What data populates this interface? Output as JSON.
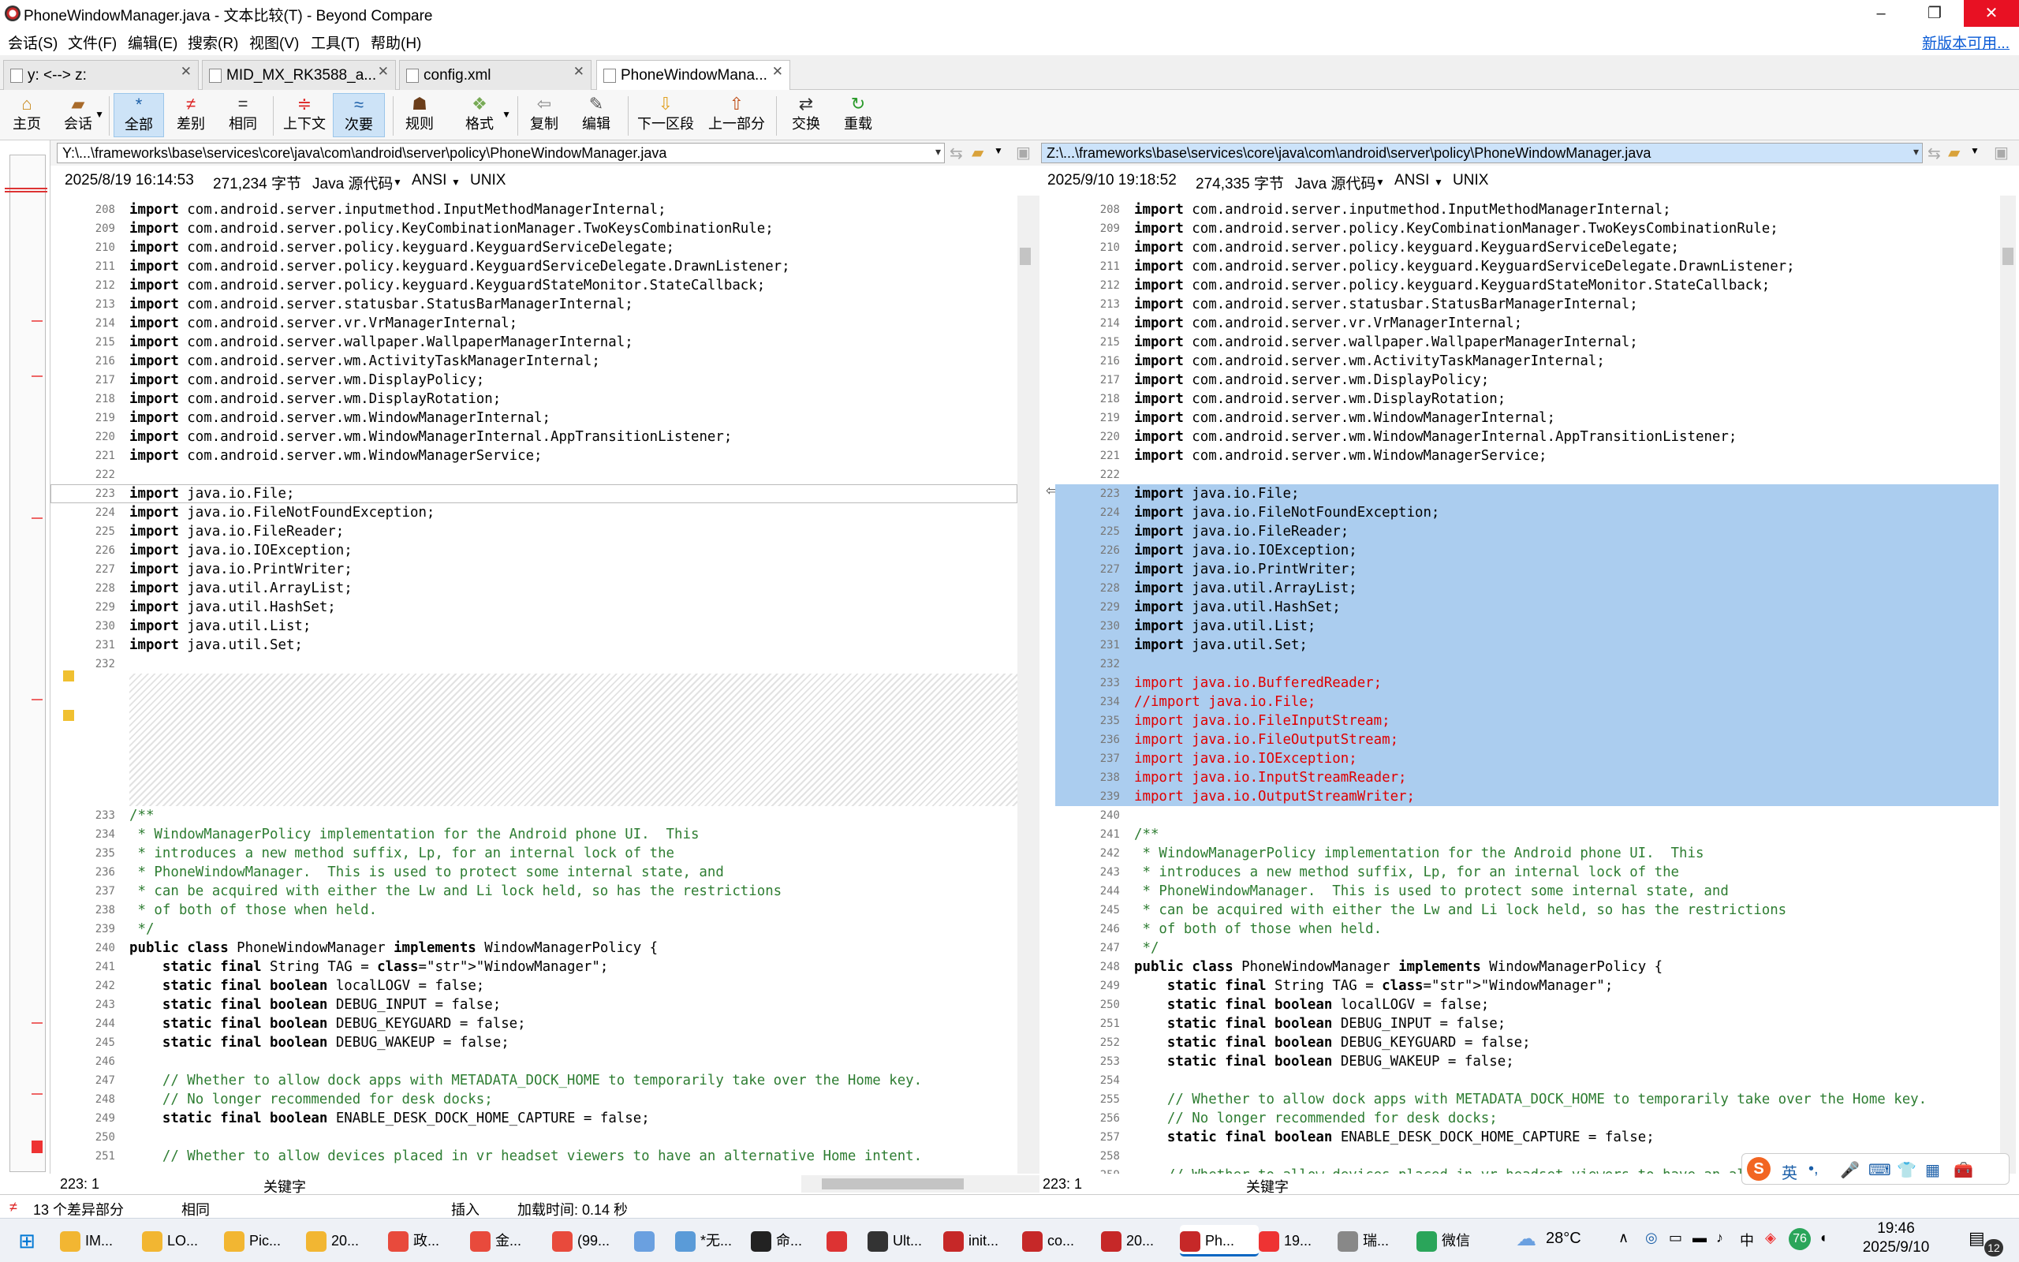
{
  "window": {
    "title": "PhoneWindowManager.java - 文本比较(T) - Beyond Compare",
    "minimize": "–",
    "restore": "❐",
    "close": "✕"
  },
  "menu": [
    "会话(S)",
    "文件(F)",
    "编辑(E)",
    "搜索(R)",
    "视图(V)",
    "工具(T)",
    "帮助(H)"
  ],
  "update_link": "新版本可用...",
  "tabs": [
    {
      "label": "y: <--> z:"
    },
    {
      "label": "MID_MX_RK3588_a..."
    },
    {
      "label": "config.xml"
    },
    {
      "label": "PhoneWindowMana..."
    }
  ],
  "toolbar": [
    "主页",
    "会话",
    "全部",
    "差别",
    "相同",
    "上下文",
    "次要",
    "规则",
    "格式",
    "复制",
    "编辑",
    "下一区段",
    "上一部分",
    "交换",
    "重载"
  ],
  "left": {
    "path": "Y:\\...\\frameworks\\base\\services\\core\\java\\com\\android\\server\\policy\\PhoneWindowManager.java",
    "date": "2025/8/19 16:14:53",
    "size": "271,234 字节",
    "type": "Java 源代码",
    "enc": "ANSI",
    "eol": "UNIX",
    "pos": "223: 1",
    "mode": "关键字"
  },
  "right": {
    "path": "Z:\\...\\frameworks\\base\\services\\core\\java\\com\\android\\server\\policy\\PhoneWindowManager.java",
    "date": "2025/9/10 19:18:52",
    "size": "274,335 字节",
    "type": "Java 源代码",
    "enc": "ANSI",
    "eol": "UNIX",
    "pos": "223: 1",
    "mode": "关键字"
  },
  "left_lines": [
    {
      "n": "208",
      "t": "import com.android.server.inputmethod.InputMethodManagerInternal;"
    },
    {
      "n": "209",
      "t": "import com.android.server.policy.KeyCombinationManager.TwoKeysCombinationRule;"
    },
    {
      "n": "210",
      "t": "import com.android.server.policy.keyguard.KeyguardServiceDelegate;"
    },
    {
      "n": "211",
      "t": "import com.android.server.policy.keyguard.KeyguardServiceDelegate.DrawnListener;"
    },
    {
      "n": "212",
      "t": "import com.android.server.policy.keyguard.KeyguardStateMonitor.StateCallback;"
    },
    {
      "n": "213",
      "t": "import com.android.server.statusbar.StatusBarManagerInternal;"
    },
    {
      "n": "214",
      "t": "import com.android.server.vr.VrManagerInternal;"
    },
    {
      "n": "215",
      "t": "import com.android.server.wallpaper.WallpaperManagerInternal;"
    },
    {
      "n": "216",
      "t": "import com.android.server.wm.ActivityTaskManagerInternal;"
    },
    {
      "n": "217",
      "t": "import com.android.server.wm.DisplayPolicy;"
    },
    {
      "n": "218",
      "t": "import com.android.server.wm.DisplayRotation;"
    },
    {
      "n": "219",
      "t": "import com.android.server.wm.WindowManagerInternal;"
    },
    {
      "n": "220",
      "t": "import com.android.server.wm.WindowManagerInternal.AppTransitionListener;"
    },
    {
      "n": "221",
      "t": "import com.android.server.wm.WindowManagerService;"
    },
    {
      "n": "222",
      "t": ""
    },
    {
      "n": "223",
      "t": "import java.io.File;"
    },
    {
      "n": "224",
      "t": "import java.io.FileNotFoundException;"
    },
    {
      "n": "225",
      "t": "import java.io.FileReader;"
    },
    {
      "n": "226",
      "t": "import java.io.IOException;"
    },
    {
      "n": "227",
      "t": "import java.io.PrintWriter;"
    },
    {
      "n": "228",
      "t": "import java.util.ArrayList;"
    },
    {
      "n": "229",
      "t": "import java.util.HashSet;"
    },
    {
      "n": "230",
      "t": "import java.util.List;"
    },
    {
      "n": "231",
      "t": "import java.util.Set;"
    },
    {
      "n": "232",
      "t": ""
    },
    {
      "n": "",
      "t": ""
    },
    {
      "n": "",
      "t": ""
    },
    {
      "n": "",
      "t": ""
    },
    {
      "n": "",
      "t": ""
    },
    {
      "n": "",
      "t": ""
    },
    {
      "n": "",
      "t": ""
    },
    {
      "n": "",
      "t": ""
    },
    {
      "n": "233",
      "t": "/**"
    },
    {
      "n": "234",
      "t": " * WindowManagerPolicy implementation for the Android phone UI.  This"
    },
    {
      "n": "235",
      "t": " * introduces a new method suffix, Lp, for an internal lock of the"
    },
    {
      "n": "236",
      "t": " * PhoneWindowManager.  This is used to protect some internal state, and"
    },
    {
      "n": "237",
      "t": " * can be acquired with either the Lw and Li lock held, so has the restrictions"
    },
    {
      "n": "238",
      "t": " * of both of those when held."
    },
    {
      "n": "239",
      "t": " */"
    },
    {
      "n": "240",
      "t": "public class PhoneWindowManager implements WindowManagerPolicy {"
    },
    {
      "n": "241",
      "t": "    static final String TAG = \"WindowManager\";"
    },
    {
      "n": "242",
      "t": "    static final boolean localLOGV = false;"
    },
    {
      "n": "243",
      "t": "    static final boolean DEBUG_INPUT = false;"
    },
    {
      "n": "244",
      "t": "    static final boolean DEBUG_KEYGUARD = false;"
    },
    {
      "n": "245",
      "t": "    static final boolean DEBUG_WAKEUP = false;"
    },
    {
      "n": "246",
      "t": ""
    },
    {
      "n": "247",
      "t": "    // Whether to allow dock apps with METADATA_DOCK_HOME to temporarily take over the Home key."
    },
    {
      "n": "248",
      "t": "    // No longer recommended for desk docks;"
    },
    {
      "n": "249",
      "t": "    static final boolean ENABLE_DESK_DOCK_HOME_CAPTURE = false;"
    },
    {
      "n": "250",
      "t": ""
    },
    {
      "n": "251",
      "t": "    // Whether to allow devices placed in vr headset viewers to have an alternative Home intent."
    }
  ],
  "right_lines": [
    {
      "n": "208",
      "t": "import com.android.server.inputmethod.InputMethodManagerInternal;"
    },
    {
      "n": "209",
      "t": "import com.android.server.policy.KeyCombinationManager.TwoKeysCombinationRule;"
    },
    {
      "n": "210",
      "t": "import com.android.server.policy.keyguard.KeyguardServiceDelegate;"
    },
    {
      "n": "211",
      "t": "import com.android.server.policy.keyguard.KeyguardServiceDelegate.DrawnListener;"
    },
    {
      "n": "212",
      "t": "import com.android.server.policy.keyguard.KeyguardStateMonitor.StateCallback;"
    },
    {
      "n": "213",
      "t": "import com.android.server.statusbar.StatusBarManagerInternal;"
    },
    {
      "n": "214",
      "t": "import com.android.server.vr.VrManagerInternal;"
    },
    {
      "n": "215",
      "t": "import com.android.server.wallpaper.WallpaperManagerInternal;"
    },
    {
      "n": "216",
      "t": "import com.android.server.wm.ActivityTaskManagerInternal;"
    },
    {
      "n": "217",
      "t": "import com.android.server.wm.DisplayPolicy;"
    },
    {
      "n": "218",
      "t": "import com.android.server.wm.DisplayRotation;"
    },
    {
      "n": "219",
      "t": "import com.android.server.wm.WindowManagerInternal;"
    },
    {
      "n": "220",
      "t": "import com.android.server.wm.WindowManagerInternal.AppTransitionListener;"
    },
    {
      "n": "221",
      "t": "import com.android.server.wm.WindowManagerService;"
    },
    {
      "n": "222",
      "t": ""
    },
    {
      "n": "223",
      "t": "import java.io.File;",
      "s": 1
    },
    {
      "n": "224",
      "t": "import java.io.FileNotFoundException;",
      "s": 1
    },
    {
      "n": "225",
      "t": "import java.io.FileReader;",
      "s": 1
    },
    {
      "n": "226",
      "t": "import java.io.IOException;",
      "s": 1
    },
    {
      "n": "227",
      "t": "import java.io.PrintWriter;",
      "s": 1
    },
    {
      "n": "228",
      "t": "import java.util.ArrayList;",
      "s": 1
    },
    {
      "n": "229",
      "t": "import java.util.HashSet;",
      "s": 1
    },
    {
      "n": "230",
      "t": "import java.util.List;",
      "s": 1
    },
    {
      "n": "231",
      "t": "import java.util.Set;",
      "s": 1
    },
    {
      "n": "232",
      "t": "",
      "s": 1
    },
    {
      "n": "233",
      "t": "import java.io.BufferedReader;",
      "s": 1,
      "r": 1
    },
    {
      "n": "234",
      "t": "//import java.io.File;",
      "s": 1,
      "r": 1,
      "c": 1
    },
    {
      "n": "235",
      "t": "import java.io.FileInputStream;",
      "s": 1,
      "r": 1
    },
    {
      "n": "236",
      "t": "import java.io.FileOutputStream;",
      "s": 1,
      "r": 1
    },
    {
      "n": "237",
      "t": "import java.io.IOException;",
      "s": 1,
      "r": 1
    },
    {
      "n": "238",
      "t": "import java.io.InputStreamReader;",
      "s": 1,
      "r": 1
    },
    {
      "n": "239",
      "t": "import java.io.OutputStreamWriter;",
      "s": 1,
      "r": 1
    },
    {
      "n": "240",
      "t": ""
    },
    {
      "n": "241",
      "t": "/**"
    },
    {
      "n": "242",
      "t": " * WindowManagerPolicy implementation for the Android phone UI.  This"
    },
    {
      "n": "243",
      "t": " * introduces a new method suffix, Lp, for an internal lock of the"
    },
    {
      "n": "244",
      "t": " * PhoneWindowManager.  This is used to protect some internal state, and"
    },
    {
      "n": "245",
      "t": " * can be acquired with either the Lw and Li lock held, so has the restrictions"
    },
    {
      "n": "246",
      "t": " * of both of those when held."
    },
    {
      "n": "247",
      "t": " */"
    },
    {
      "n": "248",
      "t": "public class PhoneWindowManager implements WindowManagerPolicy {"
    },
    {
      "n": "249",
      "t": "    static final String TAG = \"WindowManager\";"
    },
    {
      "n": "250",
      "t": "    static final boolean localLOGV = false;"
    },
    {
      "n": "251",
      "t": "    static final boolean DEBUG_INPUT = false;"
    },
    {
      "n": "252",
      "t": "    static final boolean DEBUG_KEYGUARD = false;"
    },
    {
      "n": "253",
      "t": "    static final boolean DEBUG_WAKEUP = false;"
    },
    {
      "n": "254",
      "t": ""
    },
    {
      "n": "255",
      "t": "    // Whether to allow dock apps with METADATA_DOCK_HOME to temporarily take over the Home key."
    },
    {
      "n": "256",
      "t": "    // No longer recommended for desk docks;"
    },
    {
      "n": "257",
      "t": "    static final boolean ENABLE_DESK_DOCK_HOME_CAPTURE = false;"
    },
    {
      "n": "258",
      "t": ""
    },
    {
      "n": "259",
      "t": "    // Whether to allow devices placed in vr headset viewers to have an alt"
    }
  ],
  "status": {
    "diffs": "13 个差异部分",
    "same": "相同",
    "insert": "插入",
    "load": "加载时间: 0.14 秒"
  },
  "ime": [
    "英",
    "•,",
    "🎤",
    "⌨",
    "👕",
    "▦",
    "🧰"
  ],
  "taskbar": {
    "items": [
      "IM...",
      "LO...",
      "Pic...",
      "20...",
      "政...",
      "金...",
      "(99...",
      "",
      "*无...",
      "命...",
      "",
      "Ult...",
      "init...",
      "co...",
      "20...",
      "Ph...",
      "19...",
      "瑞...",
      "微信"
    ],
    "weather": "28°C",
    "time": "19:46",
    "date": "2025/9/10",
    "notif": "12",
    "badge": "76"
  }
}
